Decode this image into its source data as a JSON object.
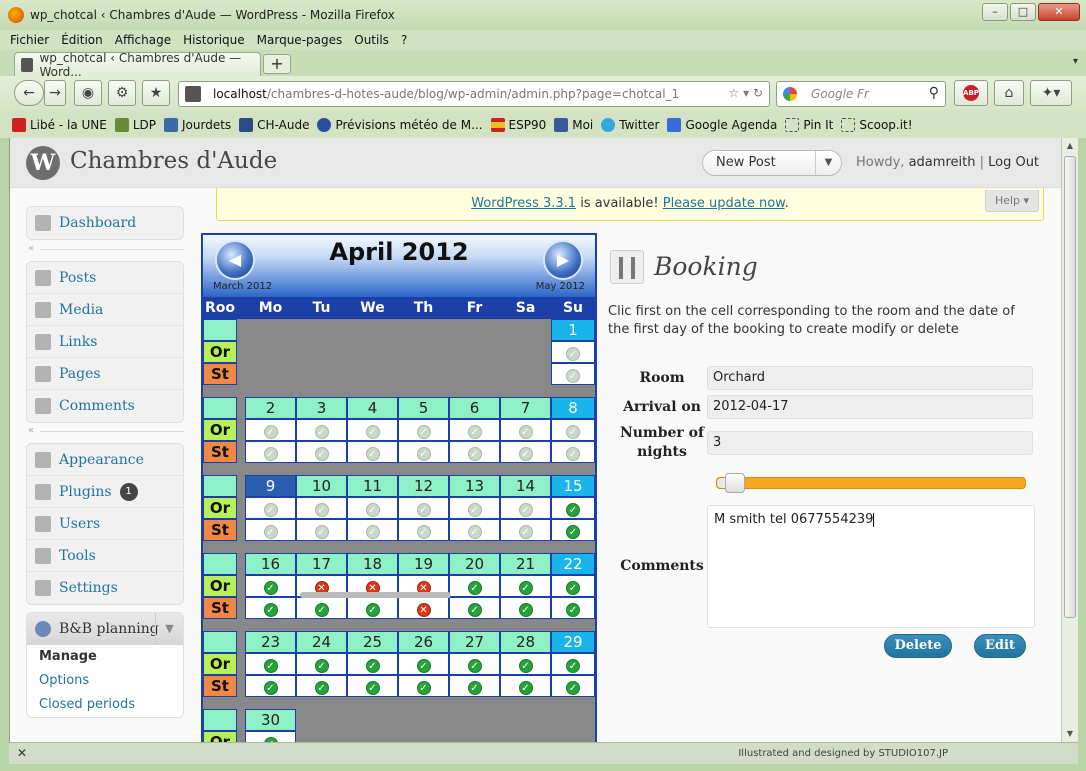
{
  "window": {
    "title": "wp_chotcal ‹ Chambres d'Aude — WordPress - Mozilla Firefox"
  },
  "menubar": [
    "Fichier",
    "Édition",
    "Affichage",
    "Historique",
    "Marque-pages",
    "Outils",
    "?"
  ],
  "tab": {
    "label": "wp_chotcal ‹ Chambres d'Aude — Word..."
  },
  "url": {
    "host": "localhost",
    "path": "/chambres-d-hotes-aude/blog/wp-admin/admin.php?page=chotcal_1"
  },
  "search": {
    "placeholder": "Google Fr"
  },
  "bookmarks": [
    "Libé - la UNE",
    "LDP",
    "Jourdets",
    "CH-Aude",
    "Prévisions météo de M...",
    "ESP90",
    "Moi",
    "Twitter",
    "Google Agenda",
    "Pin It",
    "Scoop.it!"
  ],
  "wp": {
    "site_title": "Chambres d'Aude",
    "new_post": "New Post",
    "howdy": "Howdy,",
    "user": "adamreith",
    "logout": "Log Out",
    "update_version": "WordPress 3.3.1",
    "update_mid": " is available! ",
    "update_link": "Please update now",
    "help": "Help ▾"
  },
  "sidebar": {
    "group1": [
      "Dashboard"
    ],
    "group2": [
      "Posts",
      "Media",
      "Links",
      "Pages",
      "Comments"
    ],
    "group3": [
      "Appearance",
      "Plugins",
      "Users",
      "Tools",
      "Settings"
    ],
    "plugins_badge": "1",
    "bb_title": "B&B planning",
    "bb_items": [
      "Manage",
      "Options",
      "Closed periods"
    ]
  },
  "calendar": {
    "month": "April 2012",
    "prev": "March 2012",
    "next": "May 2012",
    "headers": [
      "Roo",
      "Mo",
      "Tu",
      "We",
      "Th",
      "Fr",
      "Sa",
      "Su"
    ],
    "rooms": [
      "Or",
      "St"
    ],
    "weeks": [
      {
        "dates": [
          "",
          "",
          "",
          "",
          "",
          "",
          "1"
        ],
        "or": [
          "",
          "",
          "",
          "",
          "",
          "",
          "f"
        ],
        "st": [
          "",
          "",
          "",
          "",
          "",
          "",
          "f"
        ]
      },
      {
        "dates": [
          "2",
          "3",
          "4",
          "5",
          "6",
          "7",
          "8"
        ],
        "or": [
          "f",
          "f",
          "f",
          "f",
          "f",
          "f",
          "f"
        ],
        "st": [
          "f",
          "f",
          "f",
          "f",
          "f",
          "f",
          "f"
        ]
      },
      {
        "dates": [
          "9",
          "10",
          "11",
          "12",
          "13",
          "14",
          "15"
        ],
        "or": [
          "f",
          "f",
          "f",
          "f",
          "f",
          "f",
          "b"
        ],
        "st": [
          "f",
          "f",
          "f",
          "f",
          "f",
          "f",
          "b"
        ]
      },
      {
        "dates": [
          "16",
          "17",
          "18",
          "19",
          "20",
          "21",
          "22"
        ],
        "or": [
          "b",
          "x",
          "x",
          "x",
          "b",
          "b",
          "b"
        ],
        "st": [
          "b",
          "b",
          "b",
          "x",
          "b",
          "b",
          "b"
        ]
      },
      {
        "dates": [
          "23",
          "24",
          "25",
          "26",
          "27",
          "28",
          "29"
        ],
        "or": [
          "b",
          "b",
          "b",
          "b",
          "b",
          "b",
          "b"
        ],
        "st": [
          "b",
          "b",
          "b",
          "b",
          "b",
          "b",
          "b"
        ]
      },
      {
        "dates": [
          "30",
          "",
          "",
          "",
          "",
          "",
          ""
        ],
        "or": [
          "b",
          "",
          "",
          "",
          "",
          "",
          ""
        ],
        "st": [
          "",
          "",
          "",
          "",
          "",
          "",
          ""
        ]
      }
    ]
  },
  "booking": {
    "title": "Booking",
    "intro": "Clic first on the cell corresponding to the room and the date of the first day of the booking to create modify or delete",
    "room_label": "Room",
    "room": "Orchard",
    "arrival_label": "Arrival on",
    "arrival": "2012-04-17",
    "nights_label": "Number of nights",
    "nights": "3",
    "comments_label": "Comments",
    "comments": "M smith tel 0677554239",
    "delete": "Delete",
    "edit": "Edit"
  },
  "status": {
    "credit": "Illustrated and designed by STUDIO107.JP"
  }
}
